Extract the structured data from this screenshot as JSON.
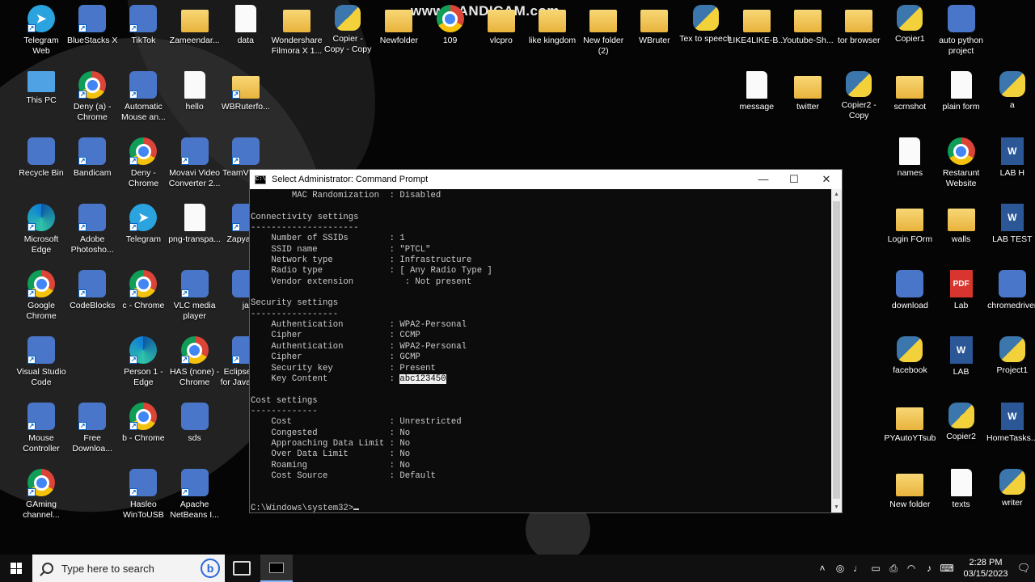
{
  "watermark": "www.BANDICAM.com",
  "desktop_icons": [
    {
      "label": "Telegram\nWeb",
      "col": 0,
      "row": 0,
      "kind": "telegram",
      "sc": true
    },
    {
      "label": "BlueStacks X",
      "col": 1,
      "row": 0,
      "kind": "generic",
      "sc": true
    },
    {
      "label": "TikTok",
      "col": 2,
      "row": 0,
      "kind": "generic",
      "sc": true
    },
    {
      "label": "Zameendar...",
      "col": 3,
      "row": 0,
      "kind": "folder",
      "sc": false
    },
    {
      "label": "data",
      "col": 4,
      "row": 0,
      "kind": "file",
      "sc": false
    },
    {
      "label": "Wondershare\nFilmora X 1...",
      "col": 5,
      "row": 0,
      "kind": "folder",
      "sc": false
    },
    {
      "label": "Copier -\nCopy - Copy",
      "col": 6,
      "row": 0,
      "kind": "py",
      "sc": false
    },
    {
      "label": "Newfolder",
      "col": 7,
      "row": 0,
      "kind": "folder",
      "sc": false
    },
    {
      "label": "109",
      "col": 8,
      "row": 0,
      "kind": "chrome",
      "sc": false
    },
    {
      "label": "vlcpro",
      "col": 9,
      "row": 0,
      "kind": "folder",
      "sc": false
    },
    {
      "label": "like kingdom",
      "col": 10,
      "row": 0,
      "kind": "folder",
      "sc": false
    },
    {
      "label": "New folder\n(2)",
      "col": 11,
      "row": 0,
      "kind": "folder",
      "sc": false
    },
    {
      "label": "WBruter",
      "col": 12,
      "row": 0,
      "kind": "folder",
      "sc": false
    },
    {
      "label": "Tex to speech",
      "col": 13,
      "row": 0,
      "kind": "py",
      "sc": false
    },
    {
      "label": "LIKE4LIKE-B...",
      "col": 14,
      "row": 0,
      "kind": "folder",
      "sc": false
    },
    {
      "label": "Youtube-Sh...",
      "col": 15,
      "row": 0,
      "kind": "folder",
      "sc": false
    },
    {
      "label": "tor browser",
      "col": 16,
      "row": 0,
      "kind": "folder",
      "sc": false
    },
    {
      "label": "Copier1",
      "col": 17,
      "row": 0,
      "kind": "py",
      "sc": false
    },
    {
      "label": "auto python\nproject",
      "col": 18,
      "row": 0,
      "kind": "generic",
      "sc": false
    },
    {
      "label": "This PC",
      "col": 0,
      "row": 1,
      "kind": "pc",
      "sc": false
    },
    {
      "label": "Deny (a) -\nChrome",
      "col": 1,
      "row": 1,
      "kind": "chrome",
      "sc": true
    },
    {
      "label": "Automatic\nMouse an...",
      "col": 2,
      "row": 1,
      "kind": "generic",
      "sc": true
    },
    {
      "label": "hello",
      "col": 3,
      "row": 1,
      "kind": "file",
      "sc": false
    },
    {
      "label": "WBRuterfo...",
      "col": 4,
      "row": 1,
      "kind": "folder",
      "sc": true
    },
    {
      "label": "message",
      "col": 14,
      "row": 1,
      "kind": "file",
      "sc": false
    },
    {
      "label": "twitter",
      "col": 15,
      "row": 1,
      "kind": "folder",
      "sc": false
    },
    {
      "label": "Copier2 -\nCopy",
      "col": 16,
      "row": 1,
      "kind": "py",
      "sc": false
    },
    {
      "label": "scrnshot",
      "col": 17,
      "row": 1,
      "kind": "folder",
      "sc": false
    },
    {
      "label": "plain form",
      "col": 18,
      "row": 1,
      "kind": "file",
      "sc": false
    },
    {
      "label": "a",
      "col": 19,
      "row": 1,
      "kind": "py",
      "sc": false
    },
    {
      "label": "Recycle Bin",
      "col": 0,
      "row": 2,
      "kind": "generic",
      "sc": false
    },
    {
      "label": "Bandicam",
      "col": 1,
      "row": 2,
      "kind": "generic",
      "sc": true
    },
    {
      "label": "Deny -\nChrome",
      "col": 2,
      "row": 2,
      "kind": "chrome",
      "sc": true
    },
    {
      "label": "Movavi Video\nConverter 2...",
      "col": 3,
      "row": 2,
      "kind": "generic",
      "sc": true
    },
    {
      "label": "TeamViewer",
      "col": 4,
      "row": 2,
      "kind": "generic",
      "sc": true
    },
    {
      "label": "names",
      "col": 17,
      "row": 2,
      "kind": "file",
      "sc": false
    },
    {
      "label": "Restarunt\nWebsite",
      "col": 18,
      "row": 2,
      "kind": "chrome",
      "sc": false
    },
    {
      "label": "LAB H",
      "col": 19,
      "row": 2,
      "kind": "word",
      "sc": false
    },
    {
      "label": "Microsoft\nEdge",
      "col": 0,
      "row": 3,
      "kind": "edge",
      "sc": true
    },
    {
      "label": "Adobe\nPhotosho...",
      "col": 1,
      "row": 3,
      "kind": "generic",
      "sc": true
    },
    {
      "label": "Telegram",
      "col": 2,
      "row": 3,
      "kind": "telegram",
      "sc": true
    },
    {
      "label": "png-transpa...",
      "col": 3,
      "row": 3,
      "kind": "file",
      "sc": false
    },
    {
      "label": "Zapya PC",
      "col": 4,
      "row": 3,
      "kind": "generic",
      "sc": true
    },
    {
      "label": "Login FOrm",
      "col": 17,
      "row": 3,
      "kind": "folder",
      "sc": false
    },
    {
      "label": "walls",
      "col": 18,
      "row": 3,
      "kind": "folder",
      "sc": false
    },
    {
      "label": "LAB TEST",
      "col": 19,
      "row": 3,
      "kind": "word",
      "sc": false
    },
    {
      "label": "Google\nChrome",
      "col": 0,
      "row": 4,
      "kind": "chrome",
      "sc": true
    },
    {
      "label": "CodeBlocks",
      "col": 1,
      "row": 4,
      "kind": "generic",
      "sc": true
    },
    {
      "label": "c - Chrome",
      "col": 2,
      "row": 4,
      "kind": "chrome",
      "sc": true
    },
    {
      "label": "VLC media\nplayer",
      "col": 3,
      "row": 4,
      "kind": "generic",
      "sc": true
    },
    {
      "label": "ja",
      "col": 4,
      "row": 4,
      "kind": "generic",
      "sc": false
    },
    {
      "label": "download",
      "col": 17,
      "row": 4,
      "kind": "generic",
      "sc": false
    },
    {
      "label": "Lab",
      "col": 18,
      "row": 4,
      "kind": "pdf",
      "sc": false
    },
    {
      "label": "chromedriver",
      "col": 19,
      "row": 4,
      "kind": "generic",
      "sc": false
    },
    {
      "label": "Visual Studio\nCode",
      "col": 0,
      "row": 5,
      "kind": "generic",
      "sc": true
    },
    {
      "label": "Person 1 -\nEdge",
      "col": 2,
      "row": 5,
      "kind": "edge",
      "sc": true
    },
    {
      "label": "HAS (none) -\nChrome",
      "col": 3,
      "row": 5,
      "kind": "chrome",
      "sc": true
    },
    {
      "label": "Eclipse IDE\nfor Java De...",
      "col": 4,
      "row": 5,
      "kind": "generic",
      "sc": true
    },
    {
      "label": "facebook",
      "col": 17,
      "row": 5,
      "kind": "py",
      "sc": false
    },
    {
      "label": "LAB",
      "col": 18,
      "row": 5,
      "kind": "word",
      "sc": false
    },
    {
      "label": "Project1",
      "col": 19,
      "row": 5,
      "kind": "py",
      "sc": false
    },
    {
      "label": "Mouse\nController",
      "col": 0,
      "row": 6,
      "kind": "generic",
      "sc": true
    },
    {
      "label": "Free\nDownloa...",
      "col": 1,
      "row": 6,
      "kind": "generic",
      "sc": true
    },
    {
      "label": "b - Chrome",
      "col": 2,
      "row": 6,
      "kind": "chrome",
      "sc": true
    },
    {
      "label": "sds",
      "col": 3,
      "row": 6,
      "kind": "generic",
      "sc": false
    },
    {
      "label": "PYAutoYTsub",
      "col": 17,
      "row": 6,
      "kind": "folder",
      "sc": false
    },
    {
      "label": "Copier2",
      "col": 18,
      "row": 6,
      "kind": "py",
      "sc": false
    },
    {
      "label": "HomeTasks...",
      "col": 19,
      "row": 6,
      "kind": "word",
      "sc": false
    },
    {
      "label": "GAming\nchannel...",
      "col": 0,
      "row": 7,
      "kind": "chrome",
      "sc": true
    },
    {
      "label": "Hasleo\nWinToUSB",
      "col": 2,
      "row": 7,
      "kind": "generic",
      "sc": true
    },
    {
      "label": "Apache\nNetBeans I...",
      "col": 3,
      "row": 7,
      "kind": "generic",
      "sc": true
    },
    {
      "label": "New folder",
      "col": 17,
      "row": 7,
      "kind": "folder",
      "sc": false
    },
    {
      "label": "texts",
      "col": 18,
      "row": 7,
      "kind": "file",
      "sc": false
    },
    {
      "label": "writer",
      "col": 19,
      "row": 7,
      "kind": "py",
      "sc": false
    }
  ],
  "cmd": {
    "title": "Select Administrator: Command Prompt",
    "lines": [
      "        MAC Randomization  : Disabled",
      "",
      "Connectivity settings",
      "---------------------",
      "    Number of SSIDs        : 1",
      "    SSID name              : \"PTCL\"",
      "    Network type           : Infrastructure",
      "    Radio type             : [ Any Radio Type ]",
      "    Vendor extension          : Not present",
      "",
      "Security settings",
      "-----------------",
      "    Authentication         : WPA2-Personal",
      "    Cipher                 : CCMP",
      "    Authentication         : WPA2-Personal",
      "    Cipher                 : GCMP",
      "    Security key           : Present",
      "    Key Content            : ",
      "",
      "Cost settings",
      "-------------",
      "    Cost                   : Unrestricted",
      "    Congested              : No",
      "    Approaching Data Limit : No",
      "    Over Data Limit        : No",
      "    Roaming                : No",
      "    Cost Source            : Default",
      "",
      "",
      "C:\\Windows\\system32>"
    ],
    "key_content_line_index": 17,
    "key_content_value": "abc123450",
    "prompt_line_index": 29
  },
  "taskbar": {
    "search_placeholder": "Type here to search",
    "bing_letter": "b",
    "time": "2:28 PM",
    "date": "03/15/2023",
    "tray_icons": [
      "chevron-up-icon",
      "meet-now-icon",
      "microphone-icon",
      "battery-icon",
      "printer-icon",
      "wifi-icon",
      "volume-icon",
      "keyboard-icon"
    ]
  }
}
